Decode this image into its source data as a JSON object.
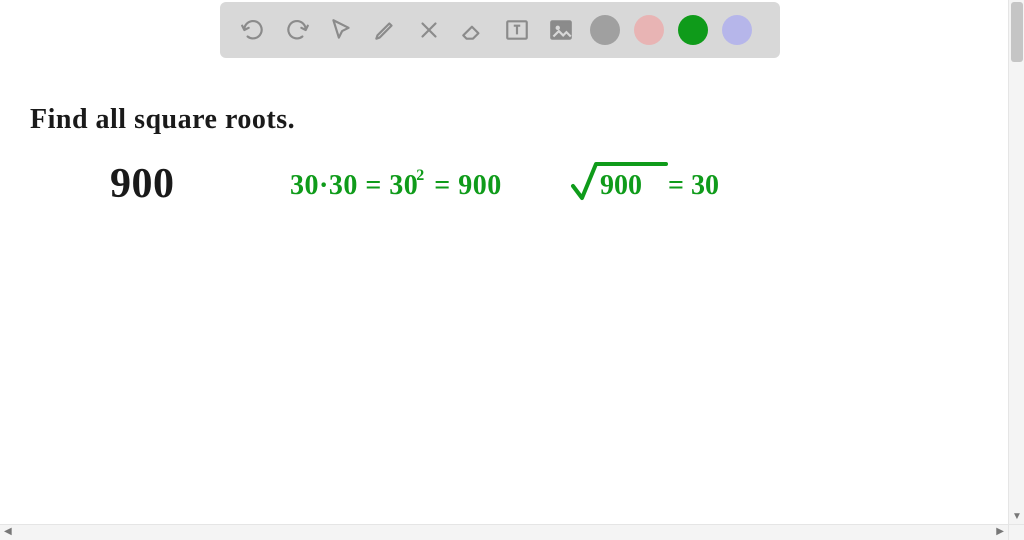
{
  "toolbar": {
    "icons": {
      "undo": "undo-icon",
      "redo": "redo-icon",
      "pointer": "pointer-icon",
      "pen": "pen-icon",
      "tools": "tools-icon",
      "eraser": "eraser-icon",
      "textbox": "textbox-icon",
      "image": "image-icon"
    },
    "colors": {
      "gray": "#a0a0a0",
      "pink": "#e8b4b4",
      "green": "#0f9b1a",
      "lilac": "#b6b6ea"
    }
  },
  "canvas": {
    "prompt": "Find all square roots.",
    "number": "900",
    "work_eq": "30·30 = 30² = 900",
    "work_eq_base": "30·30 = 30",
    "work_eq_sup": "2",
    "work_eq_tail": " = 900",
    "answer_radicand": "900",
    "answer_tail": "= 30"
  }
}
